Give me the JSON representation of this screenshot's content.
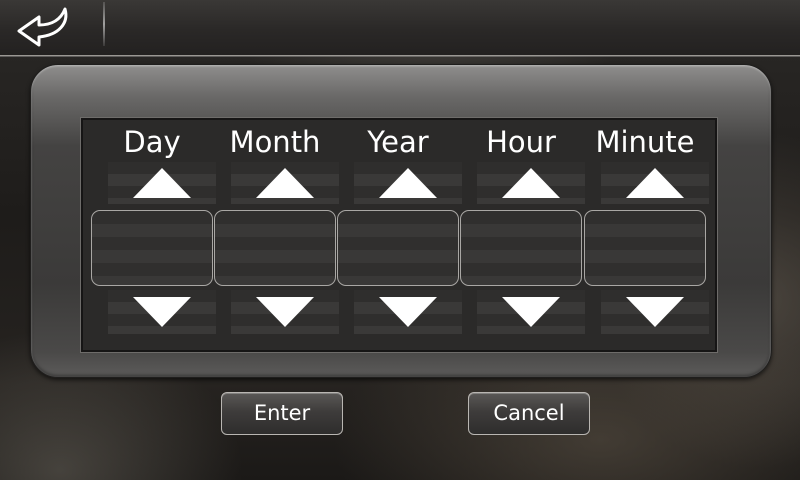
{
  "header": {
    "back_icon": "back-arrow-icon"
  },
  "datetime": {
    "fields": [
      {
        "key": "day",
        "label": "Day",
        "value": ""
      },
      {
        "key": "month",
        "label": "Month",
        "value": ""
      },
      {
        "key": "year",
        "label": "Year",
        "value": ""
      },
      {
        "key": "hour",
        "label": "Hour",
        "value": ""
      },
      {
        "key": "minute",
        "label": "Minute",
        "value": ""
      }
    ],
    "increment_icon": "triangle-up-icon",
    "decrement_icon": "triangle-down-icon"
  },
  "actions": {
    "enter_label": "Enter",
    "cancel_label": "Cancel"
  },
  "colors": {
    "text": "#ffffff",
    "panel": "#3b3a39",
    "inner": "#2b2a29"
  }
}
